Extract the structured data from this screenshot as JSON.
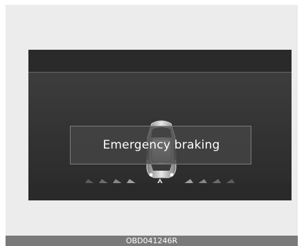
{
  "display": {
    "message": "Emergency braking",
    "warning_icon": "warning-triangle-icon",
    "vehicle_icon": "car-top-view-icon",
    "left_chevrons_icon": "chevrons-right-icon",
    "right_chevrons_icon": "chevrons-left-icon"
  },
  "footer": {
    "code": "OBD041246R"
  }
}
